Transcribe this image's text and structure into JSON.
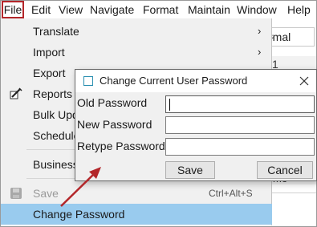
{
  "menubar": {
    "items": [
      "File",
      "Edit",
      "View",
      "Navigate",
      "Format",
      "Maintain",
      "Window",
      "Help"
    ]
  },
  "background": {
    "select_value": "rmal",
    "fragment_top": "1",
    "fragment_bottom": "me"
  },
  "file_menu": {
    "items": [
      {
        "label": "Translate",
        "has_submenu": true
      },
      {
        "label": "Import",
        "has_submenu": true
      },
      {
        "label": "Export"
      },
      {
        "label": "Reports",
        "icon": "pencil-icon"
      },
      {
        "label": "Bulk Upd"
      },
      {
        "label": "Schedule"
      },
      {
        "label": "Business"
      },
      {
        "label": "Save",
        "shortcut": "Ctrl+Alt+S",
        "disabled": true,
        "icon": "save-icon"
      },
      {
        "label": "Change Password",
        "highlighted": true
      }
    ]
  },
  "dialog": {
    "title": "Change Current User Password",
    "fields": [
      {
        "label": "Old Password",
        "value": ""
      },
      {
        "label": "New Password",
        "value": ""
      },
      {
        "label": "Retype Password",
        "value": ""
      }
    ],
    "save_label": "Save",
    "cancel_label": "Cancel"
  },
  "colors": {
    "highlight": "#99cbee",
    "annotation": "#b3262a",
    "menu_bg": "#f0f0f0"
  }
}
